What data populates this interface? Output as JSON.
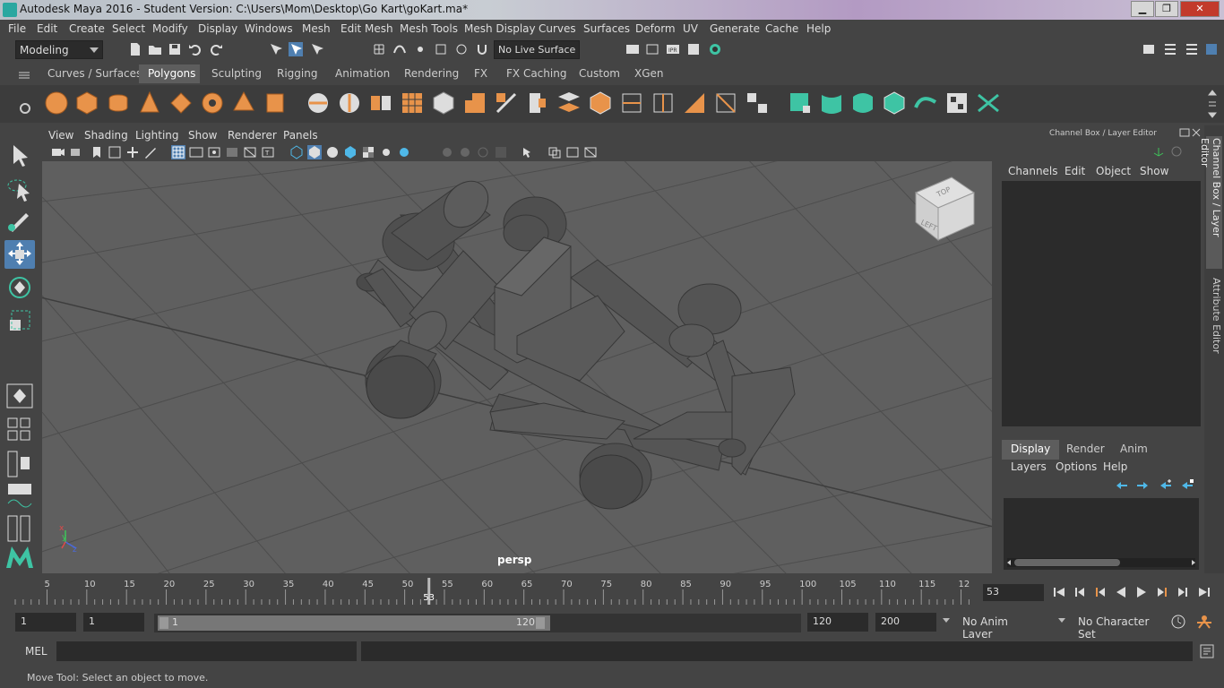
{
  "window": {
    "title": "Autodesk Maya 2016 - Student Version: C:\\Users\\Mom\\Desktop\\Go Kart\\goKart.ma*",
    "minimize": "▁",
    "maximize": "❐",
    "close": "✕"
  },
  "menubar": {
    "items": [
      "File",
      "Edit",
      "Create",
      "Select",
      "Modify",
      "Display",
      "Windows",
      "Mesh",
      "Edit Mesh",
      "Mesh Tools",
      "Mesh Display",
      "Curves",
      "Surfaces",
      "Deform",
      "UV",
      "Generate",
      "Cache",
      "Help"
    ]
  },
  "statusline": {
    "mode": "Modeling",
    "live_surface": "No Live Surface"
  },
  "shelf": {
    "tabs": [
      "Curves / Surfaces",
      "Polygons",
      "Sculpting",
      "Rigging",
      "Animation",
      "Rendering",
      "FX",
      "FX Caching",
      "Custom",
      "XGen"
    ],
    "active_tab": "Polygons"
  },
  "viewport": {
    "menu": [
      "View",
      "Shading",
      "Lighting",
      "Show",
      "Renderer",
      "Panels"
    ],
    "camera_label": "persp",
    "viewcube": {
      "top": "TOP",
      "left": "LEFT"
    },
    "axis": {
      "x": "x",
      "y": "y",
      "z": "z"
    }
  },
  "channelbox": {
    "title": "Channel Box / Layer Editor",
    "menu": [
      "Channels",
      "Edit",
      "Object",
      "Show"
    ],
    "layer_tabs": [
      "Display",
      "Render",
      "Anim"
    ],
    "active_layer_tab": "Display",
    "layer_menu": [
      "Layers",
      "Options",
      "Help"
    ]
  },
  "sidetabs": {
    "channel_box": "Channel Box / Layer Editor",
    "attribute_editor": "Attribute Editor"
  },
  "timeline": {
    "ticks": [
      "5",
      "10",
      "15",
      "20",
      "25",
      "30",
      "35",
      "40",
      "45",
      "50",
      "55",
      "60",
      "65",
      "70",
      "75",
      "80",
      "85",
      "90",
      "95",
      "100",
      "105",
      "110",
      "115",
      "12"
    ],
    "current_marker": "53",
    "current_frame": "53"
  },
  "range": {
    "start_field": "1",
    "playback_start": "1",
    "slider_start": "1",
    "slider_end": "120",
    "playback_end": "120",
    "end_field": "200",
    "anim_layer": "No Anim Layer",
    "character_set": "No Character Set"
  },
  "mel": {
    "label": "MEL"
  },
  "helpline": {
    "text": "Move Tool: Select an object to move."
  },
  "colors": {
    "accent_orange": "#e8934a",
    "accent_teal": "#3ec4a4",
    "viewport_bg": "#5f5f5f",
    "active_tool_bg": "#4f7fb0"
  }
}
